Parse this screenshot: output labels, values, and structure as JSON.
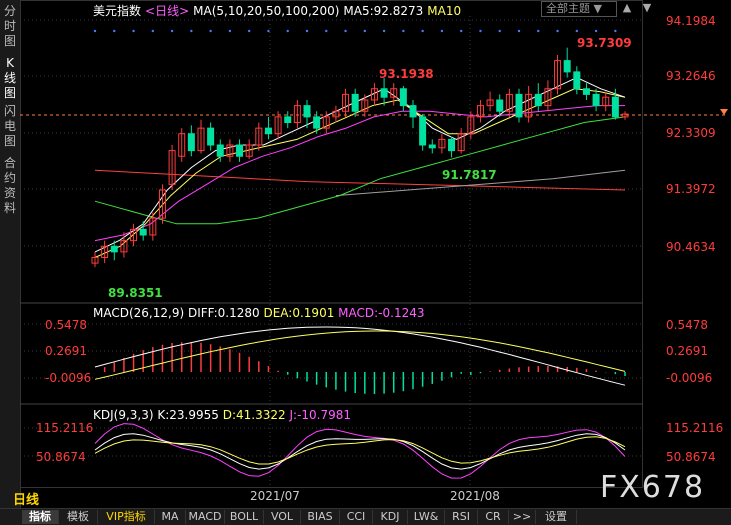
{
  "sidebar": {
    "tabs": [
      {
        "label": "分时图",
        "active": false
      },
      {
        "label": "K线图",
        "active": true
      },
      {
        "label": "闪电图",
        "active": false
      },
      {
        "label": "合约资料",
        "active": false
      }
    ]
  },
  "header": {
    "symbol": "美元指数",
    "period": "<日线>",
    "ma_params": "MA(5,10,20,50,100,200)",
    "ma5": "MA5:92.8273",
    "ma10": "MA10",
    "theme_button": "全部主题",
    "theme_arrow": "▼"
  },
  "window_controls": [
    "▲",
    "▼"
  ],
  "price_axis": [
    "94.1984",
    "93.2646",
    "92.3309",
    "91.3972",
    "90.4634"
  ],
  "price_annotations": {
    "high1": "93.1938",
    "high2": "93.7309",
    "low1": "91.7817",
    "low0": "89.8351"
  },
  "macd": {
    "label": "MACD(26,12,9)",
    "diff": "DIFF:0.1280",
    "dea": "DEA:0.1901",
    "macd": "MACD:-0.1243",
    "axis": [
      "0.5478",
      "0.2691",
      "-0.0096"
    ]
  },
  "kdj": {
    "label": "KDJ(9,3,3)",
    "k": "K:23.9955",
    "d": "D:41.3322",
    "j": "J:-10.7981",
    "axis": [
      "115.2116",
      "50.8674"
    ]
  },
  "date_axis": [
    "2021/07",
    "2021/08"
  ],
  "period_label": "日线",
  "watermark": "FX678",
  "bottom_tabs": [
    {
      "label": "指标",
      "active": true
    },
    {
      "label": "模板"
    },
    {
      "label": "VIP指标",
      "vip": true
    },
    {
      "label": "MA"
    },
    {
      "label": "MACD"
    },
    {
      "label": "BOLL"
    },
    {
      "label": "VOL"
    },
    {
      "label": "BIAS"
    },
    {
      "label": "CCI"
    },
    {
      "label": "KDJ"
    },
    {
      "label": "LW&"
    },
    {
      "label": "RSI"
    },
    {
      "label": "CR"
    },
    {
      "label": ">>"
    },
    {
      "label": "设置"
    }
  ],
  "colors": {
    "up": "#ff3c3c",
    "down": "#00e0a0",
    "ma5": "#ffffff",
    "ma10": "#ffff60",
    "ma20": "#ff40ff",
    "ma50": "#40e040",
    "ma100": "#a0a0a0",
    "ma200": "#ff4040"
  },
  "chart_data": {
    "type": "candlestick",
    "price_range": [
      89.6,
      94.4
    ],
    "candles": [
      [
        89.9,
        90.0,
        89.83,
        90.1
      ],
      [
        90.0,
        90.2,
        89.9,
        90.3
      ],
      [
        90.2,
        90.1,
        89.95,
        90.3
      ],
      [
        90.1,
        90.3,
        90.0,
        90.45
      ],
      [
        90.3,
        90.5,
        90.2,
        90.6
      ],
      [
        90.5,
        90.4,
        90.3,
        90.65
      ],
      [
        90.4,
        90.7,
        90.3,
        90.8
      ],
      [
        90.7,
        91.2,
        90.6,
        91.3
      ],
      [
        91.3,
        91.9,
        91.2,
        92.0
      ],
      [
        91.8,
        92.2,
        91.7,
        92.3
      ],
      [
        92.2,
        91.9,
        91.8,
        92.35
      ],
      [
        91.9,
        92.3,
        91.85,
        92.45
      ],
      [
        92.3,
        92.0,
        91.9,
        92.4
      ],
      [
        92.0,
        91.8,
        91.7,
        92.1
      ],
      [
        91.8,
        92.0,
        91.7,
        92.1
      ],
      [
        92.0,
        91.8,
        91.7,
        92.1
      ],
      [
        91.8,
        92.0,
        91.75,
        92.1
      ],
      [
        92.0,
        92.3,
        91.9,
        92.4
      ],
      [
        92.3,
        92.2,
        92.1,
        92.5
      ],
      [
        92.2,
        92.5,
        92.1,
        92.6
      ],
      [
        92.5,
        92.4,
        92.3,
        92.6
      ],
      [
        92.4,
        92.7,
        92.3,
        92.8
      ],
      [
        92.7,
        92.5,
        92.3,
        92.8
      ],
      [
        92.5,
        92.3,
        92.2,
        92.6
      ],
      [
        92.3,
        92.5,
        92.2,
        92.6
      ],
      [
        92.5,
        92.6,
        92.4,
        92.7
      ],
      [
        92.6,
        92.9,
        92.5,
        93.0
      ],
      [
        92.9,
        92.6,
        92.5,
        93.0
      ],
      [
        92.6,
        92.8,
        92.5,
        92.9
      ],
      [
        92.8,
        93.0,
        92.7,
        93.1
      ],
      [
        93.0,
        92.85,
        92.7,
        93.19
      ],
      [
        92.85,
        93.0,
        92.7,
        93.1
      ],
      [
        93.0,
        92.7,
        92.6,
        93.05
      ],
      [
        92.7,
        92.5,
        92.3,
        92.8
      ],
      [
        92.5,
        92.0,
        91.9,
        92.55
      ],
      [
        92.0,
        91.95,
        91.85,
        92.1
      ],
      [
        91.95,
        92.1,
        91.85,
        92.2
      ],
      [
        92.1,
        91.9,
        91.78,
        92.15
      ],
      [
        91.9,
        92.2,
        91.85,
        92.3
      ],
      [
        92.2,
        92.5,
        92.1,
        92.6
      ],
      [
        92.5,
        92.7,
        92.4,
        92.8
      ],
      [
        92.7,
        92.8,
        92.6,
        92.95
      ],
      [
        92.8,
        92.6,
        92.5,
        92.9
      ],
      [
        92.6,
        92.9,
        92.5,
        93.0
      ],
      [
        92.9,
        92.5,
        92.4,
        93.0
      ],
      [
        92.5,
        92.9,
        92.4,
        93.05
      ],
      [
        92.9,
        92.7,
        92.6,
        93.1
      ],
      [
        92.7,
        93.0,
        92.6,
        93.15
      ],
      [
        93.0,
        93.5,
        92.9,
        93.6
      ],
      [
        93.5,
        93.3,
        93.2,
        93.73
      ],
      [
        93.3,
        93.0,
        92.9,
        93.4
      ],
      [
        93.0,
        92.9,
        92.8,
        93.1
      ],
      [
        92.9,
        92.7,
        92.6,
        93.0
      ],
      [
        92.7,
        92.85,
        92.6,
        92.95
      ],
      [
        92.85,
        92.5,
        92.45,
        93.0
      ],
      [
        92.5,
        92.55,
        92.45,
        92.6
      ]
    ],
    "ma_lines": {
      "ma5": [
        90.1,
        90.3,
        90.6,
        91.2,
        91.6,
        91.9,
        92.0,
        92.0,
        92.2,
        92.4,
        92.6,
        92.8,
        93.0,
        92.7,
        92.3,
        92.1,
        92.3,
        92.6,
        92.8,
        93.0,
        93.2,
        93.0,
        92.85
      ],
      "ma10": [
        90.0,
        90.2,
        90.6,
        91.1,
        91.5,
        91.8,
        91.9,
        92.0,
        92.1,
        92.3,
        92.5,
        92.7,
        92.8,
        92.5,
        92.2,
        92.2,
        92.4,
        92.6,
        92.8,
        93.0,
        92.95,
        92.85
      ],
      "ma20": [
        90.3,
        90.4,
        90.6,
        91.0,
        91.3,
        91.6,
        91.8,
        91.95,
        92.15,
        92.3,
        92.5,
        92.6,
        92.6,
        92.55,
        92.5,
        92.55,
        92.6,
        92.65,
        92.7,
        92.7
      ],
      "ma50": [
        91.0,
        90.8,
        90.6,
        90.6,
        90.7,
        90.9,
        91.1,
        91.4,
        91.6,
        91.8,
        92.0,
        92.2,
        92.4,
        92.5
      ],
      "ma100": [
        91.1,
        91.2,
        91.3,
        91.4,
        91.55
      ],
      "ma200": [
        91.55,
        91.45,
        91.35,
        91.3,
        91.25,
        91.2
      ]
    }
  }
}
